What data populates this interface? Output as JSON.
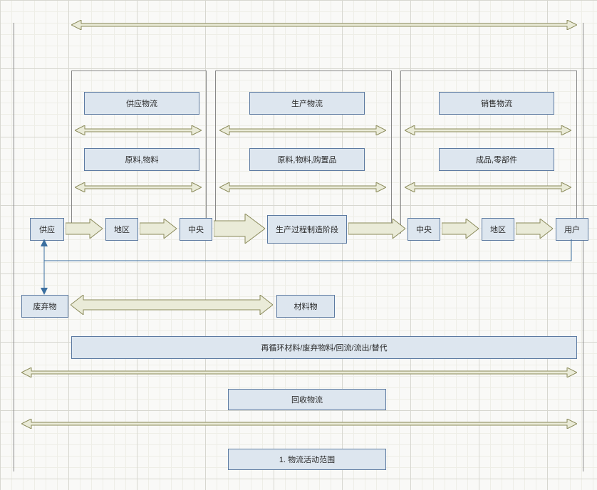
{
  "columns": {
    "col1": {
      "title": "供应物流",
      "sub": "原料,物料"
    },
    "col2": {
      "title": "生产物流",
      "sub": "原料,物料,购置品"
    },
    "col3": {
      "title": "销售物流",
      "sub": "成品,零部件"
    }
  },
  "flow": {
    "n1": "供应",
    "n2": "地区",
    "n3": "中央",
    "n4": "生产过程制造阶段",
    "n5": "中央",
    "n6": "地区",
    "n7": "用户"
  },
  "waste": {
    "left": "废弃物",
    "right": "材料物"
  },
  "recycle": "再循环材料/废弃物料/回流/流出/替代",
  "recovery": "回收物流",
  "caption": "1. 物流活动范围"
}
